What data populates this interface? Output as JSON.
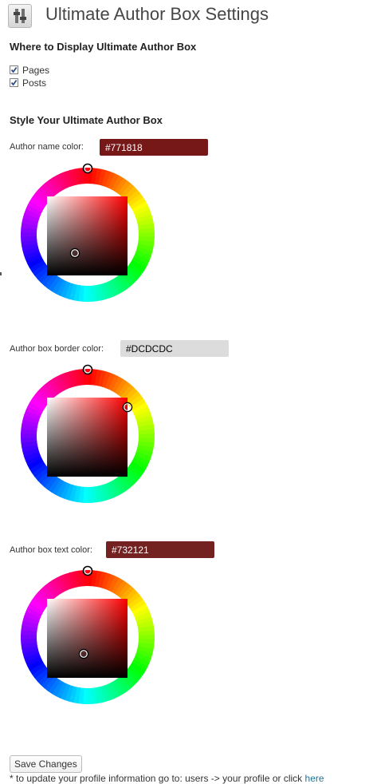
{
  "page": {
    "title": "Ultimate Author Box Settings",
    "icon": "settings-sliders-icon"
  },
  "display_section": {
    "heading": "Where to Display Ultimate Author Box",
    "options": [
      {
        "label": "Pages",
        "checked": true
      },
      {
        "label": "Posts",
        "checked": true
      }
    ]
  },
  "style_section": {
    "heading": "Style Your Ultimate Author Box",
    "pickers": [
      {
        "label": "Author name color:",
        "value": "#771818",
        "field_bg": "#771818",
        "field_text_color": "#ffffff"
      },
      {
        "label": "Author box border color:",
        "value": "#DCDCDC",
        "field_bg": "#dcdcdc",
        "field_text_color": "#000000"
      },
      {
        "label": "Author box text color:",
        "value": "#732121",
        "field_bg": "#732121",
        "field_text_color": "#ffffff"
      }
    ]
  },
  "save_button": "Save Changes",
  "footnote": {
    "text": "* to update your profile information go to: users -> your profile or click ",
    "link": "here"
  }
}
